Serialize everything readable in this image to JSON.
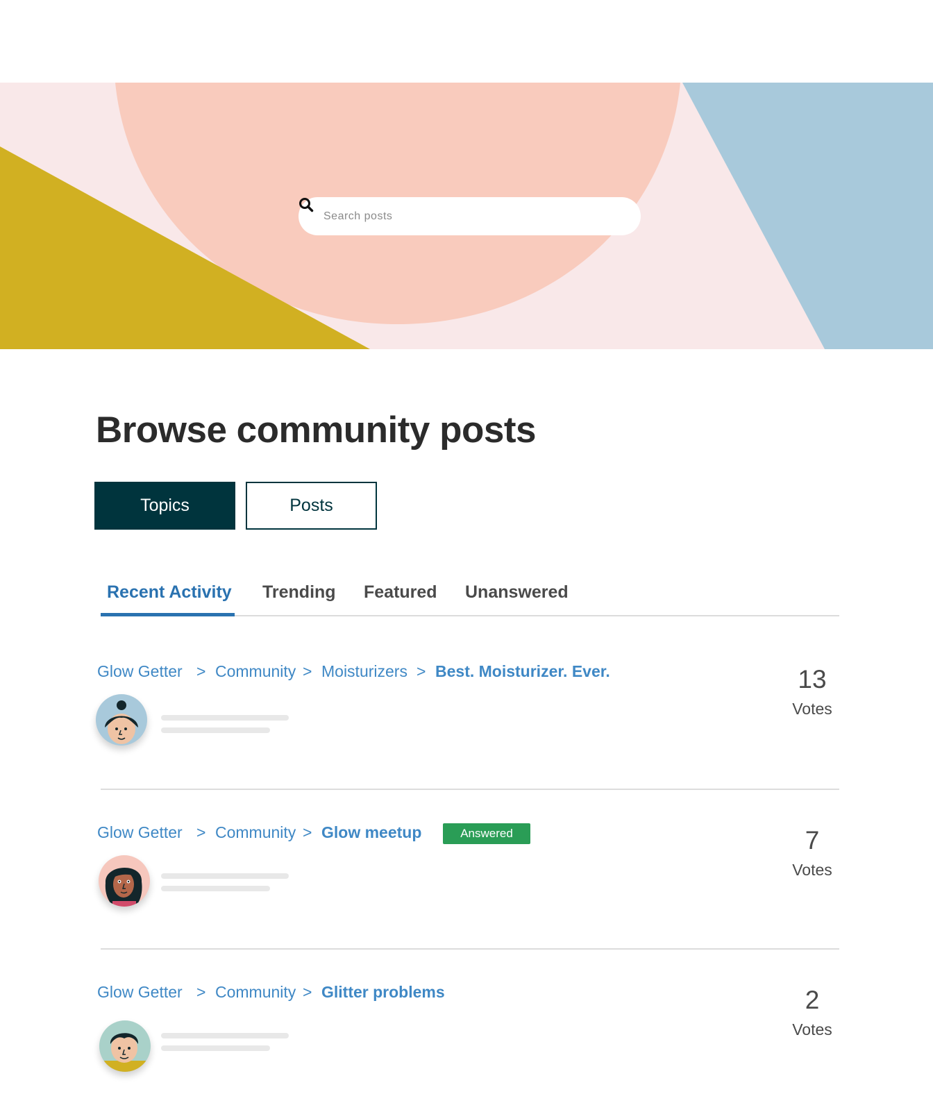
{
  "search": {
    "placeholder": "Search posts"
  },
  "page": {
    "title": "Browse community posts"
  },
  "view_toggle": {
    "topics_label": "Topics",
    "posts_label": "Posts",
    "active": "Topics"
  },
  "tabs": [
    {
      "label": "Recent Activity",
      "active": true
    },
    {
      "label": "Trending",
      "active": false
    },
    {
      "label": "Featured",
      "active": false
    },
    {
      "label": "Unanswered",
      "active": false
    }
  ],
  "posts": [
    {
      "breadcrumb": [
        "Glow Getter",
        "Community",
        "Moisturizers"
      ],
      "separator": ">",
      "title": "Best. Moisturizer. Ever.",
      "badge": "",
      "votes": "13",
      "votes_label": "Votes",
      "avatar": "woman-bun-avatar"
    },
    {
      "breadcrumb": [
        "Glow Getter",
        "Community"
      ],
      "separator": ">",
      "title": "Glow meetup",
      "badge": "Answered",
      "votes": "7",
      "votes_label": "Votes",
      "avatar": "woman-dark-hair-avatar"
    },
    {
      "breadcrumb": [
        "Glow Getter",
        "Community"
      ],
      "separator": ">",
      "title": "Glitter problems",
      "badge": "",
      "votes": "2",
      "votes_label": "Votes",
      "avatar": "man-avatar"
    }
  ],
  "colors": {
    "brand_dark": "#00343d",
    "link_blue": "#3f88c5",
    "tab_active": "#2a72b0",
    "answered_green": "#2a9d56",
    "hero_pink": "#f9e8e9",
    "hero_peach": "#f9cbbd",
    "hero_mustard": "#d1b022",
    "hero_blue": "#a8c9db"
  }
}
